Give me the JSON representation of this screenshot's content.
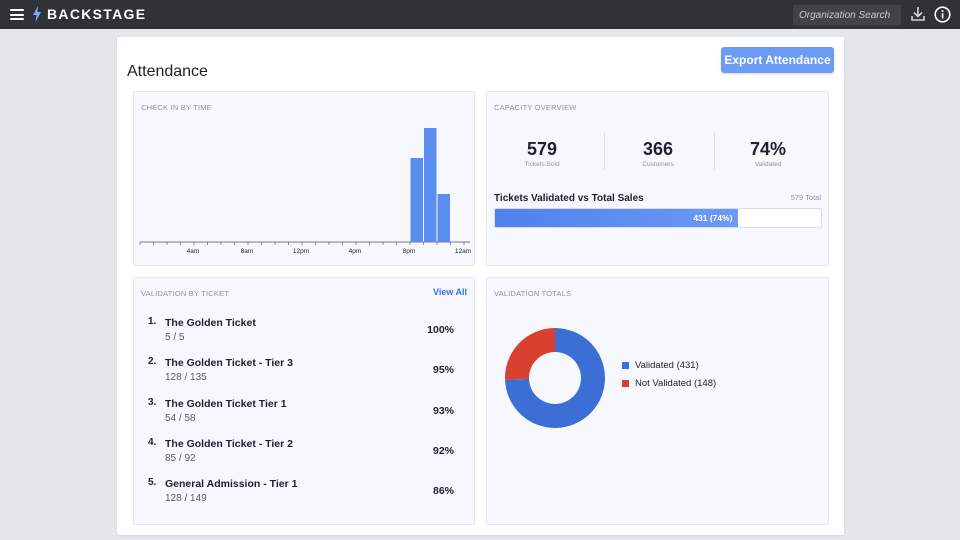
{
  "header": {
    "brand": "BACKSTAGE",
    "search_placeholder": "Organization Search",
    "icons": [
      "menu-icon",
      "bolt-icon",
      "download-icon",
      "info-icon"
    ]
  },
  "page": {
    "title": "Attendance",
    "export_label": "Export Attendance"
  },
  "checkin": {
    "title": "CHECK IN BY TIME",
    "chart_data": {
      "type": "bar",
      "title": "",
      "xlabel": "",
      "ylabel": "",
      "x_tick_labels": [
        "4am",
        "8am",
        "12pm",
        "4pm",
        "8pm",
        "12am"
      ],
      "categories": [
        "8pm-9pm",
        "9pm-10pm",
        "10pm-11pm"
      ],
      "values": [
        42,
        57,
        24
      ],
      "color": "#5b8def",
      "grid": false
    }
  },
  "capacity": {
    "title": "CAPACITY OVERVIEW",
    "stats": [
      {
        "value": "579",
        "label": "Tickets Sold"
      },
      {
        "value": "366",
        "label": "Customers"
      },
      {
        "value": "74%",
        "label": "Validated"
      }
    ],
    "bar": {
      "title": "Tickets Validated vs Total Sales",
      "total_label": "579 Total",
      "fill_label": "431 (74%)",
      "fill_fraction": 0.744
    }
  },
  "by_ticket": {
    "title": "VALIDATION BY TICKET",
    "view_all": "View All",
    "tickets": [
      {
        "num": "1.",
        "name": "The Golden Ticket",
        "count": "5 / 5",
        "pct": "100%"
      },
      {
        "num": "2.",
        "name": "The Golden Ticket - Tier 3",
        "count": "128 / 135",
        "pct": "95%"
      },
      {
        "num": "3.",
        "name": "The Golden Ticket Tier 1",
        "count": "54 / 58",
        "pct": "93%"
      },
      {
        "num": "4.",
        "name": "The Golden Ticket - Tier 2",
        "count": "85 / 92",
        "pct": "92%"
      },
      {
        "num": "5.",
        "name": "General Admission - Tier 1",
        "count": "128 / 149",
        "pct": "86%"
      }
    ]
  },
  "totals": {
    "title": "VALIDATION TOTALS",
    "chart_data": {
      "type": "pie",
      "donut": true,
      "labels": [
        "Validated",
        "Not Validated"
      ],
      "values": [
        431,
        148
      ],
      "colors": [
        "#3b6fd6",
        "#d94030"
      ]
    },
    "legend": [
      {
        "label": "Validated",
        "count": "(431)",
        "color": "#3b6fd6"
      },
      {
        "label": "Not Validated",
        "count": "(148)",
        "color": "#d94030"
      }
    ]
  }
}
